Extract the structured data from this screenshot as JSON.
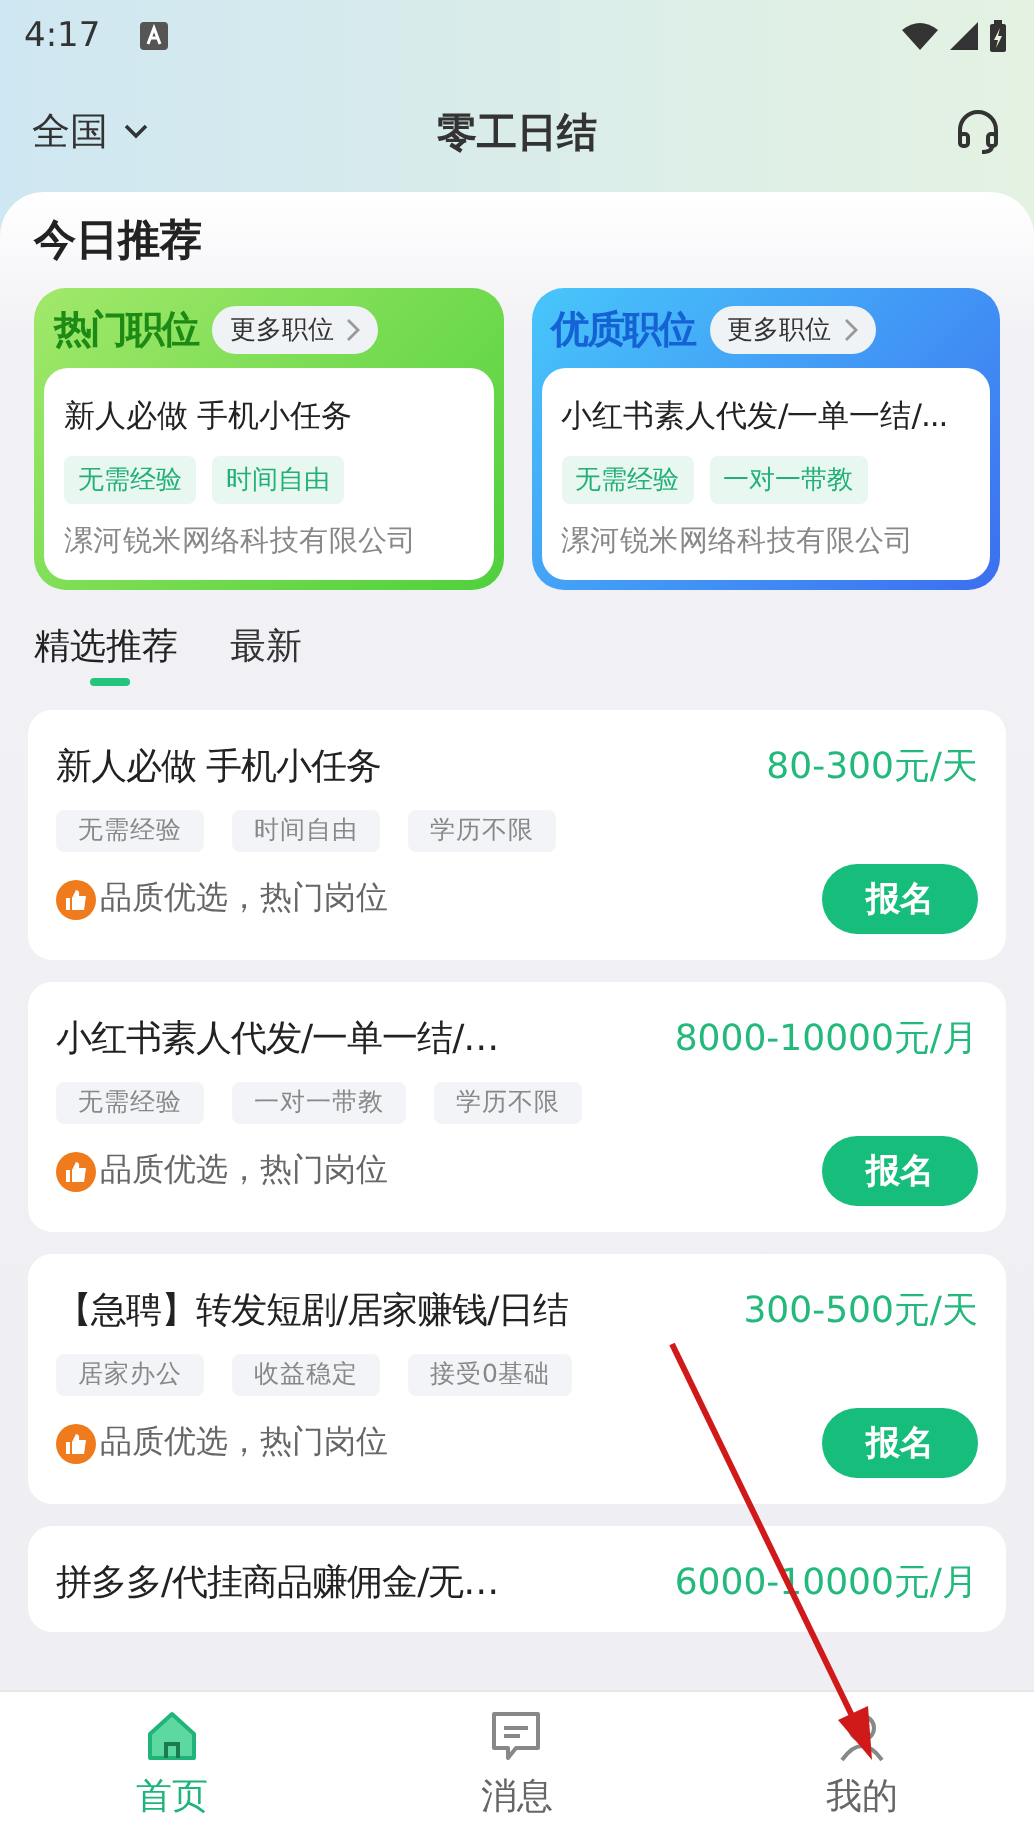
{
  "status_bar": {
    "time": "4:17"
  },
  "header": {
    "location": "全国",
    "title": "零工日结"
  },
  "section_title": "今日推荐",
  "featured": [
    {
      "kind": "green",
      "heading": "热门职位",
      "more": "更多职位",
      "job": "新人必做 手机小任务",
      "tags": [
        "无需经验",
        "时间自由"
      ],
      "company": "漯河锐米网络科技有限公司"
    },
    {
      "kind": "blue",
      "heading": "优质职位",
      "more": "更多职位",
      "job": "小红书素人代发/一单一结/...",
      "tags": [
        "无需经验",
        "一对一带教"
      ],
      "company": "漯河锐米网络科技有限公司"
    }
  ],
  "tabs": [
    {
      "label": "精选推荐",
      "selected": true
    },
    {
      "label": "最新",
      "selected": false
    }
  ],
  "jobs": [
    {
      "title": "新人必做 手机小任务",
      "pay": "80-300元/天",
      "tags": [
        "无需经验",
        "时间自由",
        "学历不限"
      ],
      "note": "品质优选，热门岗位",
      "button": "报名"
    },
    {
      "title": "小红书素人代发/一单一结/…",
      "pay": "8000-10000元/月",
      "tags": [
        "无需经验",
        "一对一带教",
        "学历不限"
      ],
      "note": "品质优选，热门岗位",
      "button": "报名"
    },
    {
      "title": "【急聘】转发短剧/居家赚钱/日结",
      "pay": "300-500元/天",
      "tags": [
        "居家办公",
        "收益稳定",
        "接受0基础"
      ],
      "note": "品质优选，热门岗位",
      "button": "报名"
    },
    {
      "title": "拼多多/代挂商品赚佣金/无…",
      "pay": "6000-10000元/月"
    }
  ],
  "bottom_nav": [
    {
      "kind": "home",
      "label": "首页",
      "selected": true
    },
    {
      "kind": "message",
      "label": "消息",
      "selected": false
    },
    {
      "kind": "profile",
      "label": "我的",
      "selected": false
    }
  ],
  "annotation_arrow": true
}
